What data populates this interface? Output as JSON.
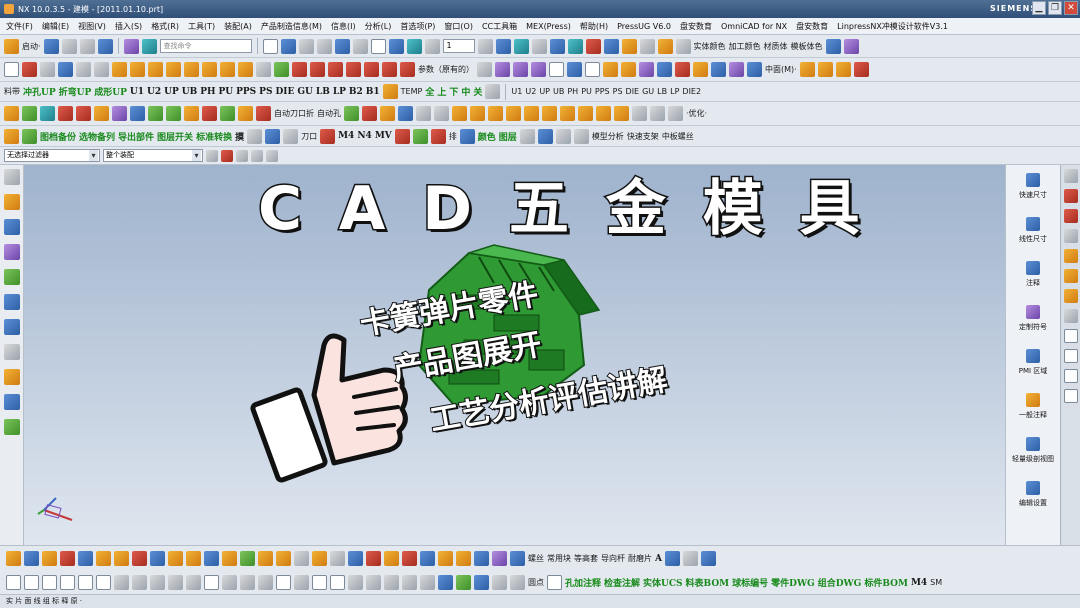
{
  "window": {
    "title": "NX 10.0.3.5 - 建模 - [2011.01.10.prt]",
    "brand": "SIEMENS",
    "minimize": "▁",
    "restore": "❐",
    "close": "✕"
  },
  "menu": [
    "文件(F)",
    "编辑(E)",
    "视图(V)",
    "插入(S)",
    "格式(R)",
    "工具(T)",
    "装配(A)",
    "产品制造信息(M)",
    "信息(I)",
    "分析(L)",
    "首选项(P)",
    "窗口(O)",
    "CC工具箱",
    "MEX(Press)",
    "帮助(H)",
    "PressUG V6.0",
    "盘安数育",
    "OmniCAD for NX",
    "盘安数育",
    "LinpressNX冲模设计软件V3.1"
  ],
  "toolbar1": {
    "start_label": "启动·",
    "search_placeholder": "查找命令",
    "page_value": "1",
    "right_labels": [
      "实体颜色",
      "加工颜色",
      "材质体",
      "模板体色"
    ]
  },
  "toolbar2": {
    "param_label": "参数（原有的）",
    "mid_label": "中面(M)·"
  },
  "toolbar3": {
    "labels": [
      "料带",
      "冲孔UP",
      "折弯UP",
      "成形UP",
      "U1",
      "U2",
      "UP",
      "UB",
      "PH",
      "PU",
      "PPS",
      "PS",
      "DIE",
      "GU",
      "LB",
      "LP",
      "B2",
      "B1",
      "TEMP",
      "全",
      "上",
      "下",
      "中",
      "关",
      "U1",
      "U2",
      "UP",
      "UB",
      "PH",
      "PU",
      "PPS",
      "PS",
      "DIE",
      "GU",
      "LB",
      "LP",
      "DIE2"
    ]
  },
  "toolbar3b": {
    "labels": [
      "自动刀口折",
      "自动孔",
      "·优化·"
    ]
  },
  "toolbar4": {
    "labels": [
      "图档备份",
      "选物备列",
      "导出部件",
      "图层开关",
      "标准转换",
      "摸",
      "刀口",
      "M4",
      "N4",
      "MV",
      "排",
      "颜色",
      "图层",
      "模型分析",
      "快速支架",
      "中板螺丝"
    ]
  },
  "filter": {
    "type_filter": "无选择过滤器",
    "scope": "整个装配"
  },
  "overlay": {
    "title": "C A D 五 金 模 具",
    "line1": "卡簧弹片零件",
    "line2": "产品图展开",
    "line3": "工艺分析评估讲解"
  },
  "right_panel": [
    "快速尺寸",
    "线性尺寸",
    "注释",
    "定制符号",
    "PMI 区域",
    "一般注释",
    "轻量级剖视图",
    "编辑设置"
  ],
  "bottom1": {
    "labels": [
      "螺丝",
      "常用块",
      "等高套",
      "导向杆",
      "耐磨片",
      "A"
    ]
  },
  "bottom2": {
    "labels": [
      "圆点",
      "孔加注释",
      "检查注解",
      "实体UCS",
      "料表BOM",
      "球标编号",
      "零件DWG",
      "组合DWG",
      "标件BOM",
      "M4",
      "SM"
    ]
  },
  "status": "实 片 面 线 组 标 释 原 ·",
  "colors": {
    "part_green": "#2f9a33",
    "part_dark": "#176b1c",
    "hand_fill": "#fbe3e0",
    "title_fill": "#ffffff"
  }
}
